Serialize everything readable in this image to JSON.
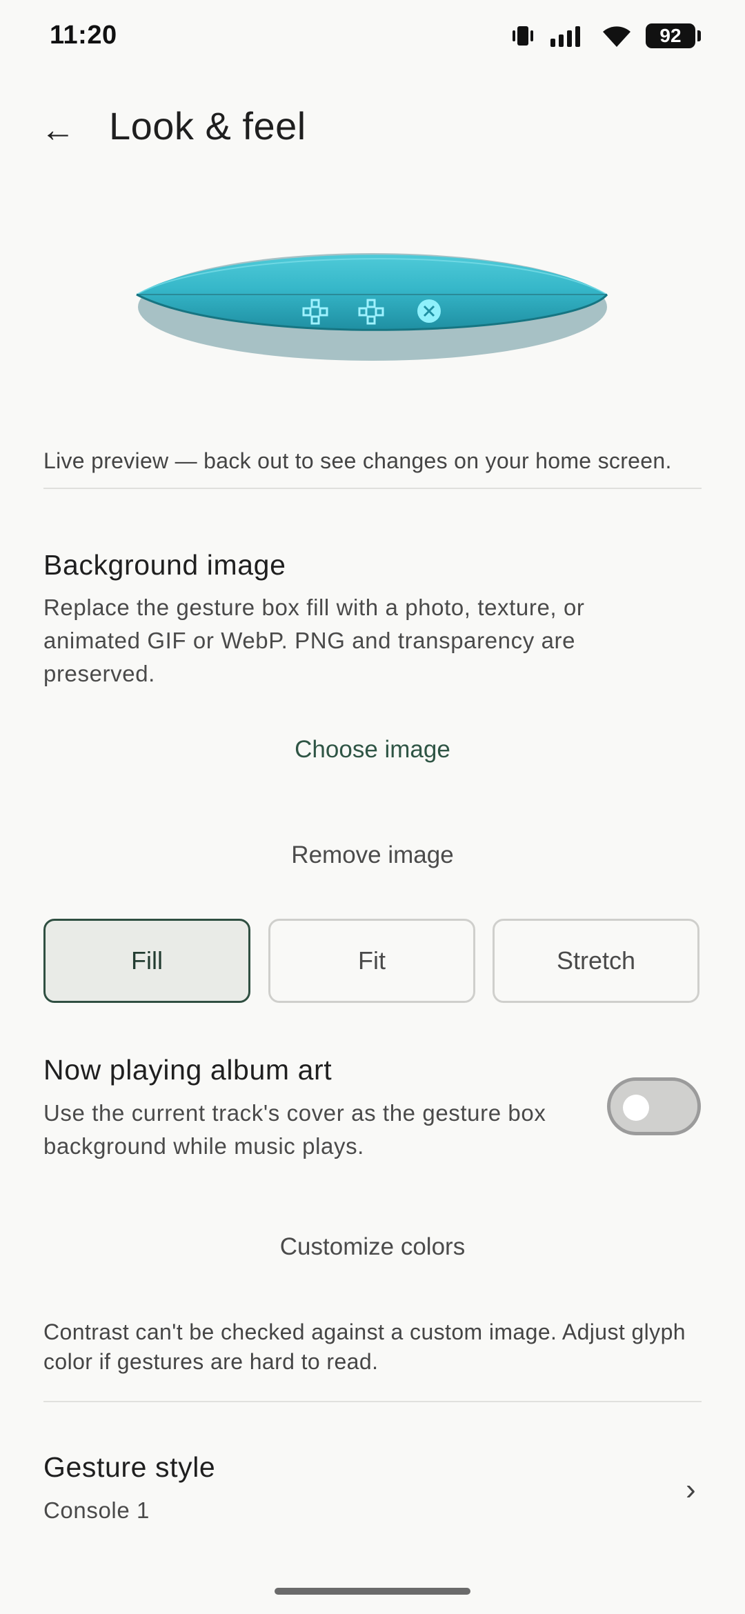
{
  "status_bar": {
    "time": "11:20",
    "battery_level": "92"
  },
  "header": {
    "back_icon": "←",
    "title": "Look & feel"
  },
  "preview": {
    "caption": "Live preview — back out to see changes on your home screen.",
    "accent_color": "#36b7c9"
  },
  "background_image": {
    "title": "Background image",
    "description": "Replace the gesture box fill with a photo, texture, or animated GIF or WebP. PNG and transparency are preserved.",
    "choose_label": "Choose image",
    "remove_label": "Remove image",
    "scale_options": [
      "Fill",
      "Fit",
      "Stretch"
    ],
    "selected_scale": "Fill"
  },
  "album_art": {
    "title": "Now playing album art",
    "description": "Use the current track's cover as the gesture box background while music plays.",
    "enabled": false
  },
  "customize_colors_label": "Customize colors",
  "contrast_note": "Contrast can't be checked against a custom image. Adjust glyph color if gestures are hard to read.",
  "gesture_style": {
    "title": "Gesture style",
    "value": "Console 1",
    "chevron": "›"
  }
}
